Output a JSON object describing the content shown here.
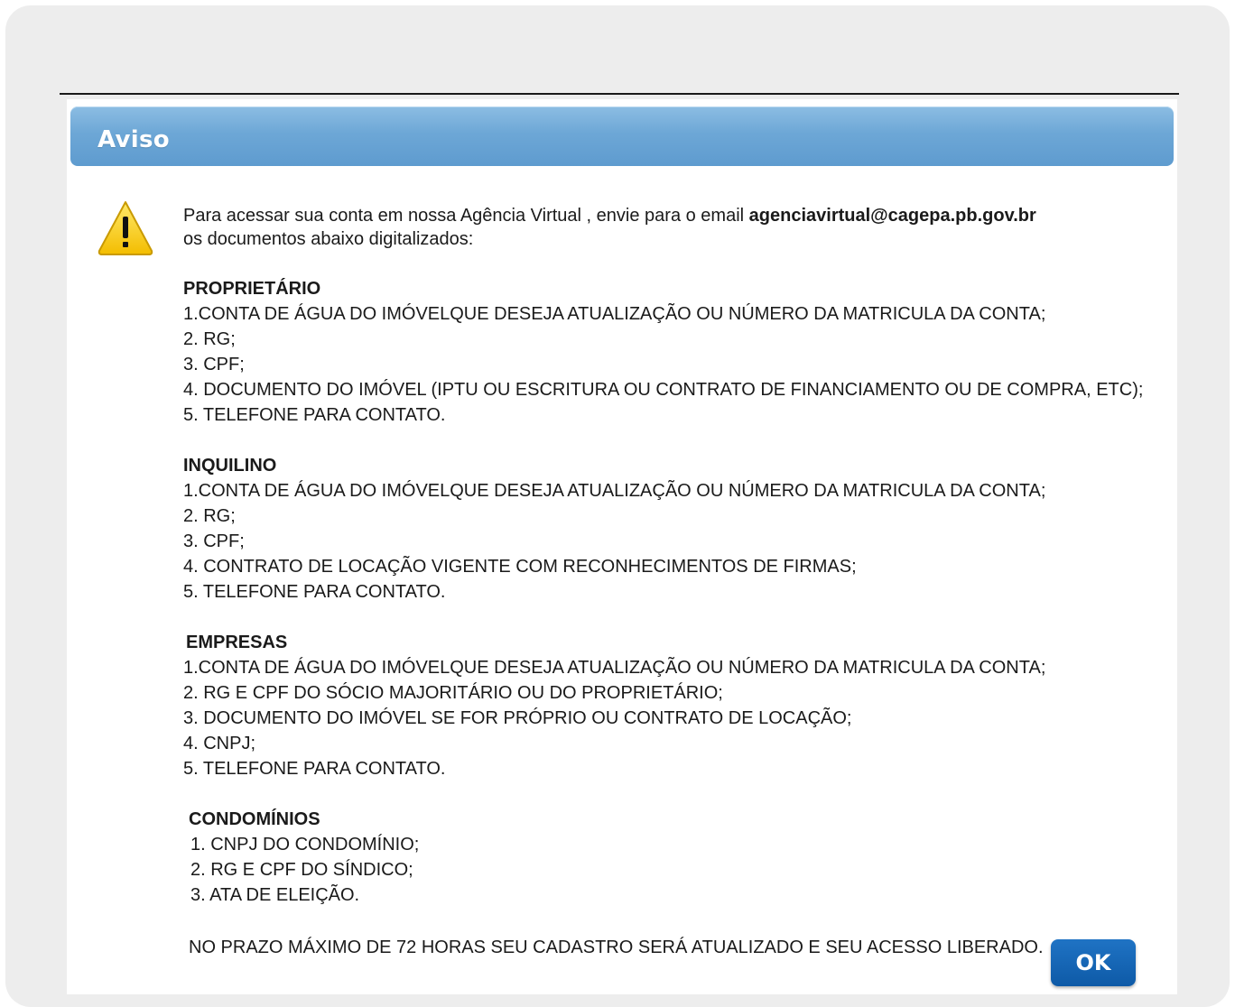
{
  "dialog": {
    "title": "Aviso",
    "icon": "warning-icon",
    "intro_text": "Para  acessar sua conta em nossa Agência Virtual , envie para o email ",
    "intro_email": "agenciavirtual@cagepa.pb.gov.br",
    "intro_text2": "os documentos abaixo digitalizados:",
    "sections": [
      {
        "heading": "PROPRIETÁRIO",
        "items": [
          "1.CONTA DE ÁGUA DO IMÓVELQUE DESEJA ATUALIZAÇÃO OU NÚMERO DA MATRICULA DA CONTA;",
          "2. RG;",
          "3. CPF;",
          "4. DOCUMENTO DO IMÓVEL (IPTU OU ESCRITURA OU CONTRATO DE FINANCIAMENTO OU DE COMPRA, ETC);",
          "5. TELEFONE PARA CONTATO."
        ]
      },
      {
        "heading": "INQUILINO",
        "items": [
          "1.CONTA DE ÁGUA DO IMÓVELQUE DESEJA ATUALIZAÇÃO OU NÚMERO DA MATRICULA DA CONTA;",
          "2. RG;",
          "3. CPF;",
          "4.  CONTRATO DE LOCAÇÃO VIGENTE COM RECONHECIMENTOS DE FIRMAS;",
          "5. TELEFONE PARA CONTATO."
        ]
      },
      {
        "heading": "EMPRESAS",
        "items": [
          "1.CONTA DE ÁGUA DO IMÓVELQUE DESEJA ATUALIZAÇÃO OU NÚMERO DA MATRICULA DA CONTA;",
          "2. RG E CPF DO SÓCIO MAJORITÁRIO OU DO PROPRIETÁRIO;",
          "3. DOCUMENTO DO IMÓVEL SE FOR PRÓPRIO OU CONTRATO DE LOCAÇÃO;",
          "4. CNPJ;",
          "5. TELEFONE PARA CONTATO."
        ]
      },
      {
        "heading": "CONDOMÍNIOS",
        "items": [
          "1. CNPJ DO CONDOMÍNIO;",
          "2. RG E CPF DO SÍNDICO;",
          "3. ATA DE ELEIÇÃO."
        ]
      }
    ],
    "footer": "NO PRAZO MÁXIMO DE 72  HORAS SEU CADASTRO SERÁ ATUALIZADO E SEU ACESSO LIBERADO.",
    "ok_label": "OK"
  },
  "colors": {
    "titlebar": "#6da7d6",
    "ok_button": "#0e5aa7",
    "warning": "#f5c400"
  }
}
